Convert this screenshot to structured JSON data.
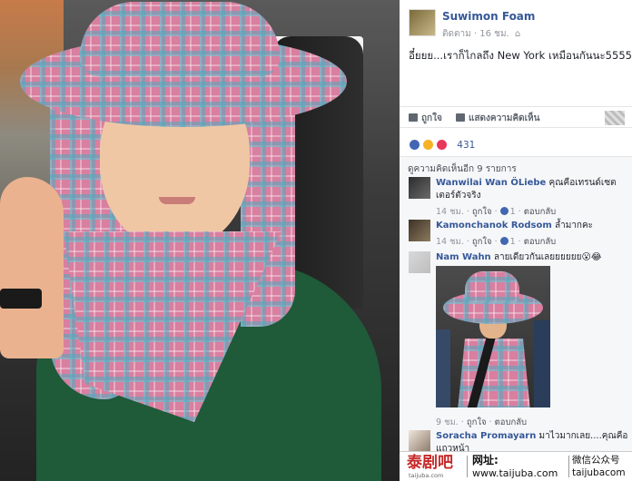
{
  "post": {
    "author": "Suwimon Foam",
    "audience": "ติดตาม",
    "time": "16 ชม.",
    "text": "อี๋ยยย...เราก็ไกลถึง New York เหมือนกันนะ5555"
  },
  "actions": {
    "like_label": "ถูกใจ",
    "comment_label": "แสดงความคิดเห็น"
  },
  "reactions": {
    "count": "431"
  },
  "comments_section": {
    "more_label": "ดูความคิดเห็นอีก 9 รายการ",
    "comments": [
      {
        "name": "Wanwilai Wan ÖLiebe",
        "text": "คุณคือเทรนด์เซตเตอร์ตัวจริง",
        "time": "14 ชม.",
        "like": "ถูกใจ",
        "likes": "1",
        "reply": "ตอบกลับ"
      },
      {
        "name": "Kamonchanok Rodsom",
        "text": "ล้ำมากคะ",
        "time": "14 ชม.",
        "like": "ถูกใจ",
        "likes": "1",
        "reply": "ตอบกลับ"
      },
      {
        "name": "Nam Wahn",
        "text": "ลายเดียวกันเลยยยยยย😮😂",
        "time": "9 ชม.",
        "like": "ถูกใจ",
        "reply": "ตอบกลับ"
      },
      {
        "name": "Soracha Promayarn",
        "text": "มาไวมากเลย....คุณคือแถวหน้า"
      }
    ]
  },
  "watermark": {
    "logo": "泰剧吧",
    "logo_sub": "taijuba.com",
    "site_label": "网址:",
    "site_url": "www.taijuba.com",
    "wechat_label": "微信公众号",
    "wechat_id": "taijubacom"
  },
  "colors": {
    "link": "#365899",
    "meta": "#90949c",
    "like_blue": "#4267b2",
    "love_red": "#e9365b",
    "haha_yellow": "#f7b125"
  }
}
